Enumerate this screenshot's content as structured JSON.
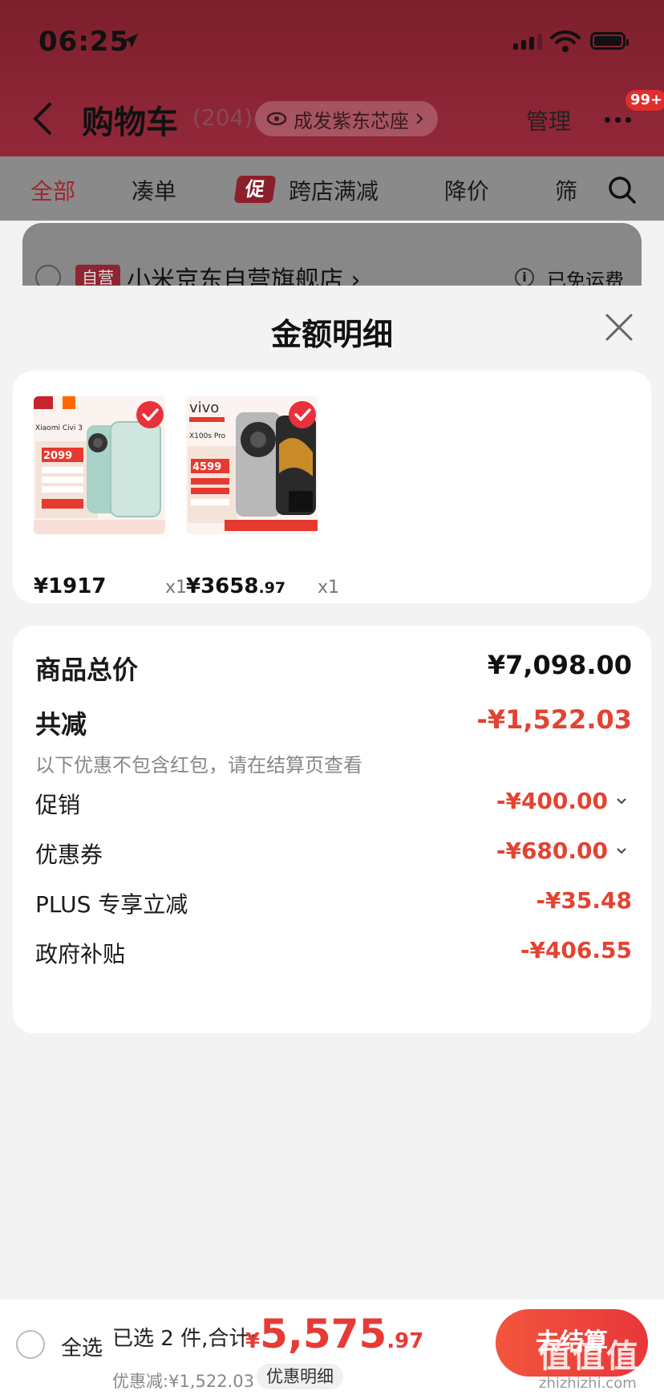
{
  "status_bar": {
    "time": "06:25"
  },
  "nav": {
    "title": "购物车",
    "count": "(204)",
    "location": "成发紫东芯座",
    "manage": "管理",
    "message_badge": "99+"
  },
  "filter_tabs": {
    "all": "全部",
    "bundle": "凑单",
    "promo_icon": "促",
    "cross_store": "跨店满减",
    "price_drop": "降价",
    "filter": "筛"
  },
  "store": {
    "self_tag": "自营",
    "name": "小米京东自营旗舰店 ›",
    "shipping": "已免运费"
  },
  "sheet": {
    "title": "金额明细"
  },
  "products": [
    {
      "brand": "Xiaomi Civi 3",
      "img_price": "2099",
      "price_main": "¥1917",
      "price_decimal": "",
      "qty": "x1",
      "accent": "#e8313a"
    },
    {
      "brand": "vivo",
      "model": "X100s Pro",
      "img_price": "4599",
      "price_main": "¥3658",
      "price_decimal": ".97",
      "qty": "x1",
      "accent": "#e8313a"
    }
  ],
  "summary": {
    "total_label": "商品总价",
    "total_value": "¥7,098.00",
    "discount_label": "共减",
    "discount_value": "-¥1,522.03",
    "note": "以下优惠不包含红包，请在结算页查看",
    "items": [
      {
        "label": "促销",
        "value": "-¥400.00",
        "expandable": true
      },
      {
        "label": "优惠券",
        "value": "-¥680.00",
        "expandable": true
      },
      {
        "label": "PLUS 专享立减",
        "value": "-¥35.48",
        "expandable": false
      },
      {
        "label": "政府补贴",
        "value": "-¥406.55",
        "expandable": false
      }
    ]
  },
  "checkout": {
    "select_all": "全选",
    "selected_text": "已选 2 件,合计:",
    "total_yen": "¥",
    "total_int": "5,575",
    "total_dec": ".97",
    "saved": "优惠减:¥1,522.03",
    "detail_button": "优惠明细",
    "checkout_button": "去结算"
  },
  "watermark": {
    "main": "值值值",
    "sub": "zhizhizhi.com"
  },
  "colors": {
    "accent_red": "#e83a34",
    "discount_red": "#e34332",
    "header_bg": "#7d1f2c"
  }
}
